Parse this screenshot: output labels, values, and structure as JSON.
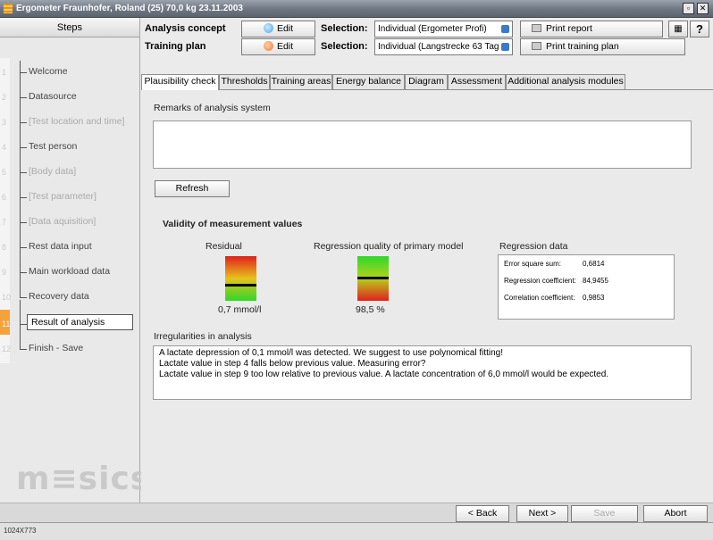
{
  "window": {
    "title": "Ergometer Fraunhofer, Roland (25) 70,0 kg 23.11.2003",
    "buttons": {
      "restore": "▫",
      "close": "✕"
    }
  },
  "sidebar": {
    "header": "Steps",
    "items": [
      {
        "num": "1",
        "label": "Welcome",
        "state": "normal"
      },
      {
        "num": "2",
        "label": "Datasource",
        "state": "normal"
      },
      {
        "num": "3",
        "label": "[Test location and time]",
        "state": "disabled"
      },
      {
        "num": "4",
        "label": "Test person",
        "state": "normal"
      },
      {
        "num": "5",
        "label": "[Body data]",
        "state": "disabled"
      },
      {
        "num": "6",
        "label": "[Test parameter]",
        "state": "disabled"
      },
      {
        "num": "7",
        "label": "[Data aquisition]",
        "state": "disabled"
      },
      {
        "num": "8",
        "label": "Rest data input",
        "state": "normal"
      },
      {
        "num": "9",
        "label": "Main workload data",
        "state": "normal"
      },
      {
        "num": "10",
        "label": "Recovery data",
        "state": "normal"
      },
      {
        "num": "11",
        "label": "Result of analysis",
        "state": "active"
      },
      {
        "num": "12",
        "label": "Finish - Save",
        "state": "normal"
      }
    ],
    "brand": "m≡sics"
  },
  "toolbar": {
    "analysis": {
      "label": "Analysis concept",
      "edit": "Edit",
      "selection_label": "Selection:",
      "selection_value": "Individual (Ergometer Profi)",
      "print": "Print report"
    },
    "training": {
      "label": "Training plan",
      "edit": "Edit",
      "selection_label": "Selection:",
      "selection_value": "Individual (Langstrecke 63 Tag",
      "print": "Print training plan"
    },
    "help": "?"
  },
  "tabs": [
    {
      "label": "Plausibility check",
      "active": true
    },
    {
      "label": "Thresholds",
      "active": false
    },
    {
      "label": "Training areas",
      "active": false
    },
    {
      "label": "Energy balance",
      "active": false
    },
    {
      "label": "Diagram",
      "active": false
    },
    {
      "label": "Assessment",
      "active": false
    },
    {
      "label": "Additional analysis modules",
      "active": false
    }
  ],
  "plausibility": {
    "remarks_label": "Remarks of analysis system",
    "refresh": "Refresh",
    "validity_heading": "Validity of measurement values",
    "residual": {
      "label": "Residual",
      "value": "0,7 mmol/l"
    },
    "regression_quality": {
      "label": "Regression quality of primary model",
      "value": "98,5 %"
    },
    "regression_data": {
      "label": "Regression data",
      "rows": [
        {
          "name": "Error square sum:",
          "value": "0,6814"
        },
        {
          "name": "Regression coefficient:",
          "value": "84,9455"
        },
        {
          "name": "Correlation coefficient:",
          "value": "0,9853"
        }
      ]
    },
    "irregularities": {
      "label": "Irregularities in analysis",
      "lines": [
        "A lactate depression of 0,1 mmol/l was detected. We suggest to use polynomical fitting!",
        "Lactate value in step 4 falls below previous value. Measuring error?",
        "Lactate value in step 9 too low relative to previous value. A lactate concentration of 6,0 mmol/l would be expected."
      ]
    }
  },
  "navigation": {
    "back": "< Back",
    "next": "Next >",
    "save": "Save",
    "abort": "Abort"
  },
  "status": {
    "resolution": "1024X773"
  },
  "colors": {
    "accent": "#f6a23a",
    "gauge_top": "#e0201c",
    "gauge_bottom": "#2ed82a"
  }
}
